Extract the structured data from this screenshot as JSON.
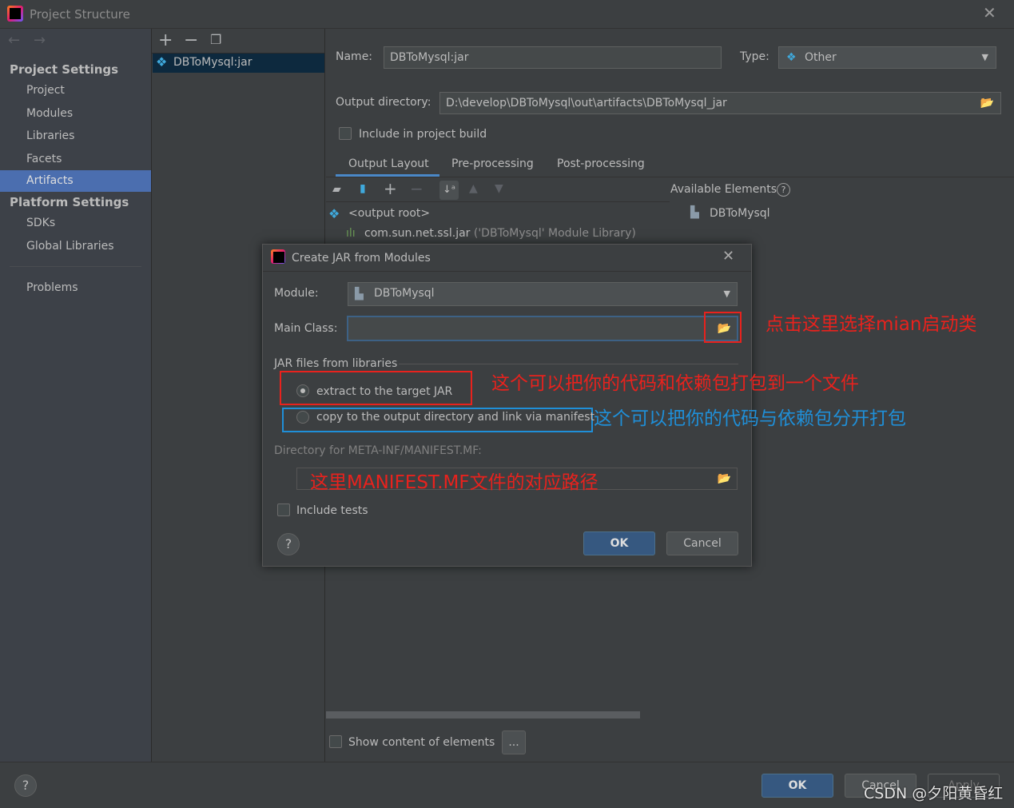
{
  "window": {
    "title": "Project Structure"
  },
  "sidebar": {
    "project_settings": "Project Settings",
    "items": [
      {
        "label": "Project"
      },
      {
        "label": "Modules"
      },
      {
        "label": "Libraries"
      },
      {
        "label": "Facets"
      },
      {
        "label": "Artifacts",
        "selected": true
      }
    ],
    "platform_settings": "Platform Settings",
    "platform_items": [
      {
        "label": "SDKs"
      },
      {
        "label": "Global Libraries"
      }
    ],
    "problems": "Problems"
  },
  "artifacts": {
    "list": [
      "DBToMysql:jar"
    ]
  },
  "editor": {
    "name_label": "Name:",
    "name_value": "DBToMysql:jar",
    "type_label": "Type:",
    "type_value": "Other",
    "output_dir_label": "Output directory:",
    "output_dir_value": "D:\\develop\\DBToMysql\\out\\artifacts\\DBToMysql_jar",
    "include_build": "Include in project build",
    "tabs": [
      {
        "label": "Output Layout",
        "active": true
      },
      {
        "label": "Pre-processing"
      },
      {
        "label": "Post-processing"
      }
    ],
    "available_elements": "Available Elements",
    "tree": [
      "<output root>",
      "com.sun.net.ssl.jar"
    ],
    "tree_note": "('DBToMysql' Module Library)",
    "available": [
      "DBToMysql"
    ],
    "show_content": "Show content of elements",
    "ellipsis": "..."
  },
  "footer": {
    "ok": "OK",
    "cancel": "Cancel",
    "apply": "Apply",
    "help": "?"
  },
  "dialog": {
    "title": "Create JAR from Modules",
    "module_label": "Module:",
    "module_value": "DBToMysql",
    "main_class_label": "Main Class:",
    "main_class_value": "",
    "jar_group": "JAR files from libraries",
    "option_extract": "extract to the target JAR",
    "option_copy": "copy to the output directory and link via manifest",
    "manifest_label": "Directory for META-INF/MANIFEST.MF:",
    "manifest_value": "",
    "include_tests": "Include tests",
    "ok": "OK",
    "cancel": "Cancel",
    "help": "?"
  },
  "annotations": {
    "main_class": "点击这里选择mian启动类",
    "extract": "这个可以把你的代码和依赖包打包到一个文件",
    "copy": "这个可以把你的代码与依赖包分开打包",
    "manifest": "这里MANIFEST.MF文件的对应路径"
  },
  "watermark": "CSDN @夕阳黄昏红",
  "colors": {
    "selection": "#4b6eaf",
    "annotation_red": "#e8221d",
    "annotation_blue": "#1f8fd8",
    "primary_button": "#365880"
  }
}
